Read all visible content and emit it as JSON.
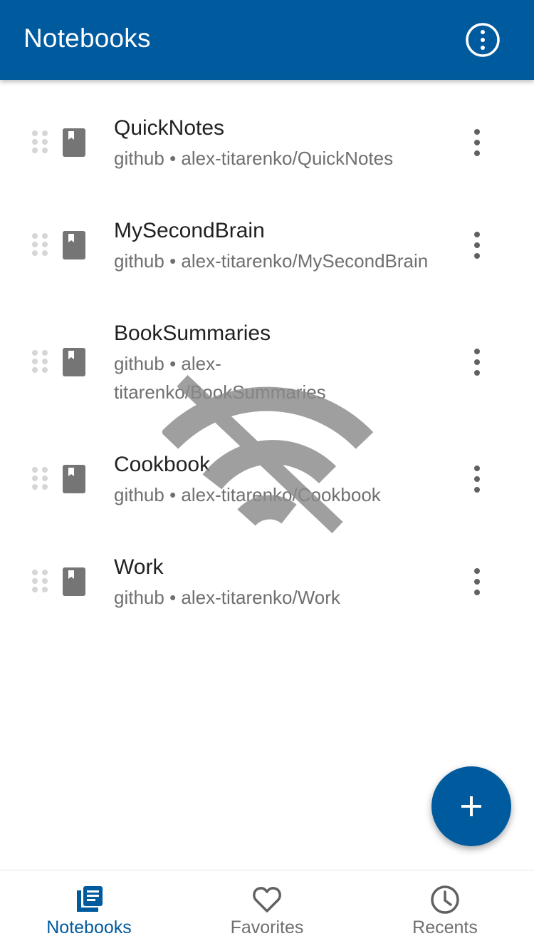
{
  "appbar": {
    "title": "Notebooks",
    "menu_icon": "more-vert-circle-icon"
  },
  "notebooks": [
    {
      "name": "QuickNotes",
      "provider": "github",
      "separator": "•",
      "repo": "alex-titarenko/QuickNotes"
    },
    {
      "name": "MySecondBrain",
      "provider": "github",
      "separator": "•",
      "repo": "alex-titarenko/MySecondBrain"
    },
    {
      "name": "BookSummaries",
      "provider": "github",
      "separator": "•",
      "repo_line1": "alex-",
      "repo_line2": "titarenko/BookSummaries"
    },
    {
      "name": "Cookbook",
      "provider": "github",
      "separator": "•",
      "repo": "alex-titarenko/Cookbook"
    },
    {
      "name": "Work",
      "provider": "github",
      "separator": "•",
      "repo": "alex-titarenko/Work"
    }
  ],
  "overlay": {
    "icon": "wifi-off-icon"
  },
  "fab": {
    "icon": "plus-icon"
  },
  "bottom_nav": [
    {
      "label": "Notebooks",
      "icon": "notebooks-icon",
      "active": true
    },
    {
      "label": "Favorites",
      "icon": "heart-icon",
      "active": false
    },
    {
      "label": "Recents",
      "icon": "clock-icon",
      "active": false
    }
  ],
  "colors": {
    "primary": "#005a9e",
    "text": "#212121",
    "secondary_text": "#6f6f6f",
    "icon_gray": "#757575",
    "handle_gray": "#d6d6d6"
  }
}
